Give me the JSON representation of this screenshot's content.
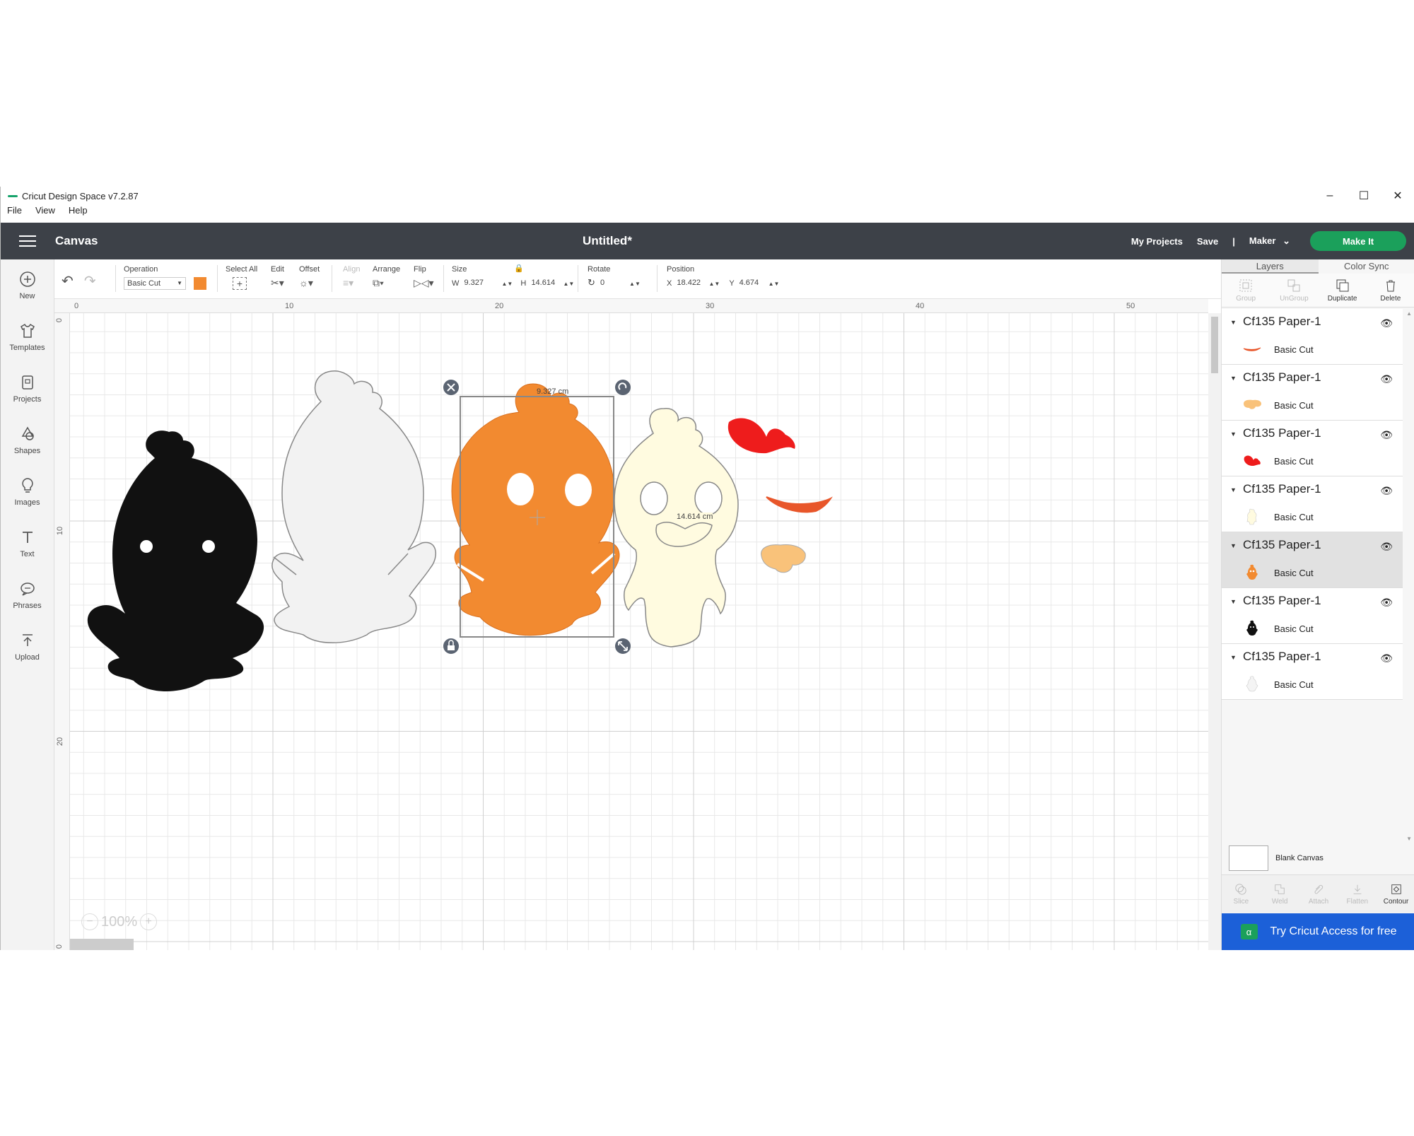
{
  "window": {
    "app_title": "Cricut Design Space  v7.2.87"
  },
  "menu": [
    "File",
    "View",
    "Help"
  ],
  "header": {
    "section": "Canvas",
    "doc_title": "Untitled*",
    "my_projects": "My Projects",
    "save": "Save",
    "divider": "|",
    "machine": "Maker",
    "make_it": "Make It"
  },
  "left_tools": [
    {
      "label": "New",
      "icon": "plus-circle-icon"
    },
    {
      "label": "Templates",
      "icon": "shirt-icon"
    },
    {
      "label": "Projects",
      "icon": "projects-icon"
    },
    {
      "label": "Shapes",
      "icon": "shapes-icon"
    },
    {
      "label": "Images",
      "icon": "lightbulb-icon"
    },
    {
      "label": "Text",
      "icon": "text-icon"
    },
    {
      "label": "Phrases",
      "icon": "speech-bubble-icon"
    },
    {
      "label": "Upload",
      "icon": "upload-icon"
    }
  ],
  "toolbar": {
    "operation_label": "Operation",
    "operation_value": "Basic Cut",
    "operation_color": "#f28a30",
    "select_all": "Select All",
    "edit": "Edit",
    "offset": "Offset",
    "align": "Align",
    "arrange": "Arrange",
    "flip": "Flip",
    "size": "Size",
    "w_label": "W",
    "w_value": "9.327",
    "h_label": "H",
    "h_value": "14.614",
    "rotate": "Rotate",
    "rotate_value": "0",
    "position": "Position",
    "x_label": "X",
    "x_value": "18.422",
    "y_label": "Y",
    "y_value": "4.674"
  },
  "rulers": {
    "h_ticks": [
      "0",
      "10",
      "20",
      "30",
      "40",
      "50"
    ],
    "v_ticks": [
      "0",
      "10",
      "20",
      "0"
    ]
  },
  "canvas": {
    "width_label": "9.327 cm",
    "height_label": "14.614 cm",
    "zoom": "100%"
  },
  "panel": {
    "tab_layers": "Layers",
    "tab_color_sync": "Color Sync",
    "tools": [
      {
        "label": "Group",
        "enabled": false
      },
      {
        "label": "UnGroup",
        "enabled": false
      },
      {
        "label": "Duplicate",
        "enabled": true
      },
      {
        "label": "Delete",
        "enabled": true
      }
    ],
    "layers": [
      {
        "name": "Cf135 Paper-1",
        "op": "Basic Cut",
        "color": "#e8562a",
        "thumb": "mouth",
        "selected": false
      },
      {
        "name": "Cf135 Paper-1",
        "op": "Basic Cut",
        "color": "#f9c27a",
        "thumb": "beak",
        "selected": false
      },
      {
        "name": "Cf135 Paper-1",
        "op": "Basic Cut",
        "color": "#ee1c1c",
        "thumb": "comb",
        "selected": false
      },
      {
        "name": "Cf135 Paper-1",
        "op": "Basic Cut",
        "color": "#fffbe0",
        "thumb": "chick",
        "selected": false
      },
      {
        "name": "Cf135 Paper-1",
        "op": "Basic Cut",
        "color": "#f28a30",
        "thumb": "chick",
        "selected": true
      },
      {
        "name": "Cf135 Paper-1",
        "op": "Basic Cut",
        "color": "#111111",
        "thumb": "chick",
        "selected": false
      },
      {
        "name": "Cf135 Paper-1",
        "op": "Basic Cut",
        "color": "#f4f4f4",
        "thumb": "chick",
        "selected": false
      }
    ],
    "blank_canvas": "Blank Canvas",
    "bottom_tools": [
      {
        "label": "Slice",
        "enabled": false
      },
      {
        "label": "Weld",
        "enabled": false
      },
      {
        "label": "Attach",
        "enabled": false
      },
      {
        "label": "Flatten",
        "enabled": false
      },
      {
        "label": "Contour",
        "enabled": true
      }
    ],
    "cta": "Try Cricut Access for free"
  },
  "colors": {
    "header_bg": "#3d4148",
    "make_it": "#1ba05b",
    "cta_bg": "#1c60d8"
  }
}
